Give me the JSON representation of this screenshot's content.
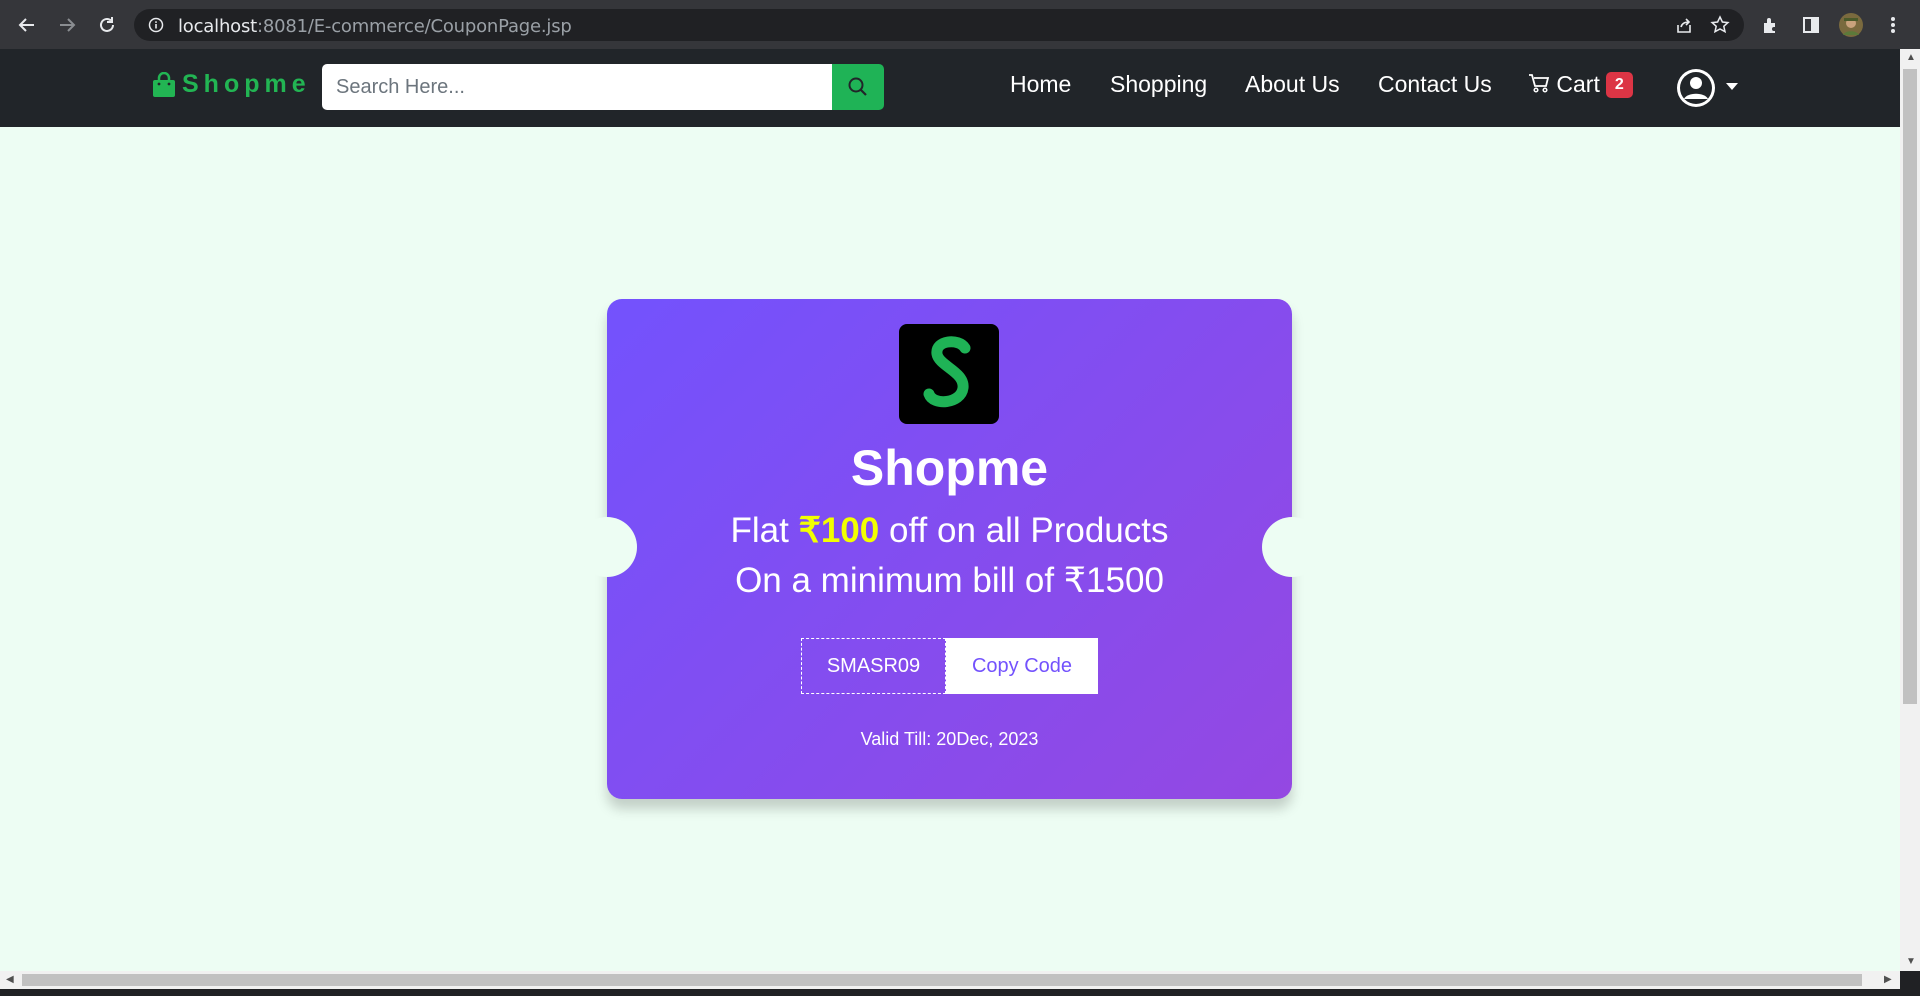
{
  "browser": {
    "url_host": "localhost",
    "url_path": ":8081/E-commerce/CouponPage.jsp"
  },
  "header": {
    "brand": "Shopme",
    "search_placeholder": "Search Here...",
    "nav": [
      {
        "label": "Home"
      },
      {
        "label": "Shopping"
      },
      {
        "label": "About Us"
      },
      {
        "label": "Contact Us"
      }
    ],
    "cart_label": "Cart",
    "cart_count": "2"
  },
  "coupon": {
    "logo_letter": "S",
    "title": "Shopme",
    "line1_prefix": "Flat ",
    "line1_amount": "₹100",
    "line1_suffix": " off on all Products",
    "line2": "On a minimum bill of ₹1500",
    "code": "SMASR09",
    "copy_label": "Copy Code",
    "valid_till": "Valid Till: 20Dec, 2023"
  },
  "colors": {
    "brand_green": "#22b553",
    "coupon_gradient_start": "#7352fd",
    "coupon_gradient_end": "#9448e2",
    "amount_yellow": "#f2ff00",
    "badge_red": "#dc3545",
    "page_bg": "#edfdf3"
  }
}
